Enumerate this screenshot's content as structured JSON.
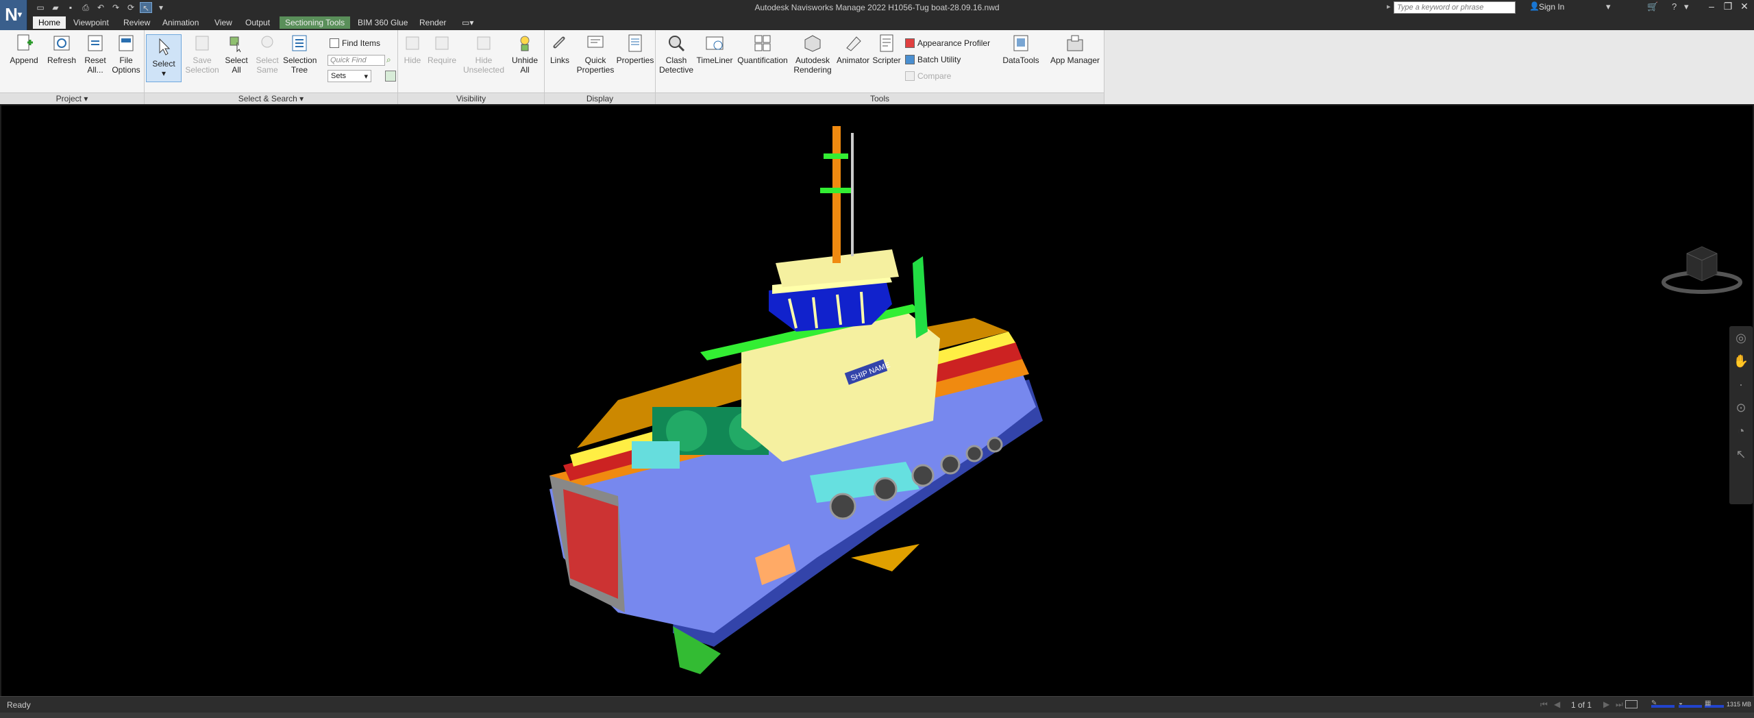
{
  "titlebar": {
    "title": "Autodesk Navisworks Manage 2022    H1056-Tug boat-28.09.16.nwd",
    "search_placeholder": "Type a keyword or phrase",
    "signin_label": "Sign In"
  },
  "tabs": [
    {
      "label": "Home"
    },
    {
      "label": "Viewpoint"
    },
    {
      "label": "Review"
    },
    {
      "label": "Animation"
    },
    {
      "label": "View"
    },
    {
      "label": "Output"
    },
    {
      "label": "Sectioning Tools"
    },
    {
      "label": "BIM 360 Glue"
    },
    {
      "label": "Render"
    }
  ],
  "ribbon": {
    "project": {
      "title": "Project",
      "append": "Append",
      "refresh": "Refresh",
      "reset_all": "Reset All...",
      "file_options": "File Options"
    },
    "select_search": {
      "title": "Select & Search",
      "select": "Select",
      "save_selection": "Save Selection",
      "select_all": "Select All",
      "select_same": "Select Same",
      "selection_tree": "Selection Tree",
      "find_items": "Find Items",
      "quick_find_placeholder": "Quick Find",
      "sets": "Sets"
    },
    "visibility": {
      "title": "Visibility",
      "hide": "Hide",
      "require": "Require",
      "hide_unselected": "Hide Unselected",
      "unhide_all": "Unhide All"
    },
    "display": {
      "title": "Display",
      "links": "Links",
      "quick_properties": "Quick Properties",
      "properties": "Properties"
    },
    "tools": {
      "title": "Tools",
      "clash_detective": "Clash Detective",
      "timeliner": "TimeLiner",
      "quantification": "Quantification",
      "autodesk_rendering": "Autodesk Rendering",
      "animator": "Animator",
      "scripter": "Scripter",
      "appearance_profiler": "Appearance Profiler",
      "batch_utility": "Batch Utility",
      "compare": "Compare",
      "datatools": "DataTools",
      "app_manager": "App Manager"
    }
  },
  "model": {
    "ship_name_label": "SHIP NAME"
  },
  "statusbar": {
    "status": "Ready",
    "page_counter": "1 of 1",
    "memory": "1315 MB"
  }
}
